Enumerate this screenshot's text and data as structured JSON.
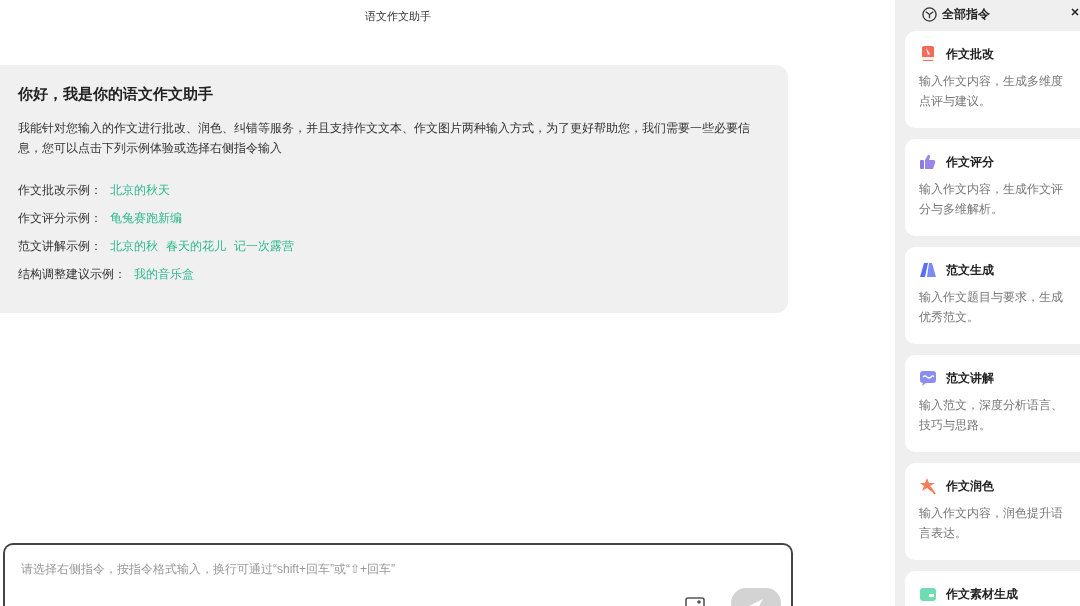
{
  "header": {
    "title": "语文作文助手"
  },
  "welcome": {
    "heading": "你好，我是你的语文作文助手",
    "intro": "我能针对您输入的作文进行批改、润色、纠错等服务，并且支持作文文本、作文图片两种输入方式，为了更好帮助您，我们需要一些必要信息，您可以点击下列示例体验或选择右侧指令输入",
    "examples": [
      {
        "label": "作文批改示例：",
        "links": [
          "北京的秋天"
        ]
      },
      {
        "label": "作文评分示例：",
        "links": [
          "龟兔赛跑新编"
        ]
      },
      {
        "label": "范文讲解示例：",
        "links": [
          "北京的秋",
          "春天的花儿",
          "记一次露营"
        ]
      },
      {
        "label": "结构调整建议示例：",
        "links": [
          "我的音乐盒"
        ]
      }
    ]
  },
  "composer": {
    "placeholder": "请选择右侧指令，按指令格式输入，换行可通过“shift+回车”或“⇧+回车”"
  },
  "commands": {
    "title": "全部指令",
    "items": [
      {
        "kind": "pen",
        "title": "作文批改",
        "description": "输入作文内容，生成多维度点评与建议。"
      },
      {
        "kind": "thumb",
        "title": "作文评分",
        "description": "输入作文内容，生成作文评分与多维解析。"
      },
      {
        "kind": "book",
        "title": "范文生成",
        "description": "输入作文题目与要求，生成优秀范文。"
      },
      {
        "kind": "chat",
        "title": "范文讲解",
        "description": "输入范文，深度分析语言、技巧与思路。"
      },
      {
        "kind": "star",
        "title": "作文润色",
        "description": "输入作文内容，润色提升语言表达。"
      },
      {
        "kind": "card",
        "title": "作文素材生成"
      }
    ]
  }
}
